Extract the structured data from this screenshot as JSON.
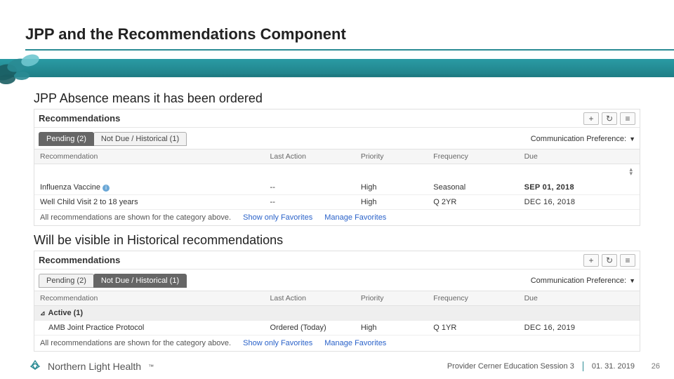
{
  "header": {
    "title": "JPP and the Recommendations Component"
  },
  "section1": {
    "lead": "JPP Absence means it has been ordered"
  },
  "section2": {
    "lead": "Will be visible in Historical recommendations"
  },
  "widgets": {
    "title": "Recommendations",
    "icons": {
      "plus": "+",
      "refresh": "↻",
      "menu": "≡"
    },
    "commpref_label": "Communication Preference:",
    "tabs": {
      "pending": "Pending (2)",
      "historical": "Not Due / Historical (1)"
    },
    "cols": {
      "rec": "Recommendation",
      "la": "Last Action",
      "pr": "Priority",
      "fr": "Frequency",
      "due": "Due"
    },
    "footer": {
      "msg": "All recommendations are shown for the category above.",
      "fav": "Show only Favorites",
      "manage": "Manage Favorites"
    }
  },
  "widget1": {
    "rows": [
      {
        "rec": "Influenza Vaccine",
        "info": "i",
        "la": "--",
        "pr": "High",
        "fr": "Seasonal",
        "due": "SEP 01, 2018",
        "due_style": "red"
      },
      {
        "rec": "Well Child Visit 2 to 18 years",
        "la": "--",
        "pr": "High",
        "fr": "Q 2YR",
        "due": "DEC 16, 2018",
        "due_style": "blk"
      }
    ]
  },
  "widget2": {
    "group": "Active (1)",
    "rows": [
      {
        "rec": "AMB Joint Practice Protocol",
        "la": "Ordered (Today)",
        "pr": "High",
        "fr": "Q 1YR",
        "due": "DEC 16, 2019",
        "due_style": "blk"
      }
    ]
  },
  "footer": {
    "brand": "Northern Light Health",
    "session": "Provider Cerner Education Session 3",
    "date": "01. 31. 2019",
    "page": "26"
  }
}
